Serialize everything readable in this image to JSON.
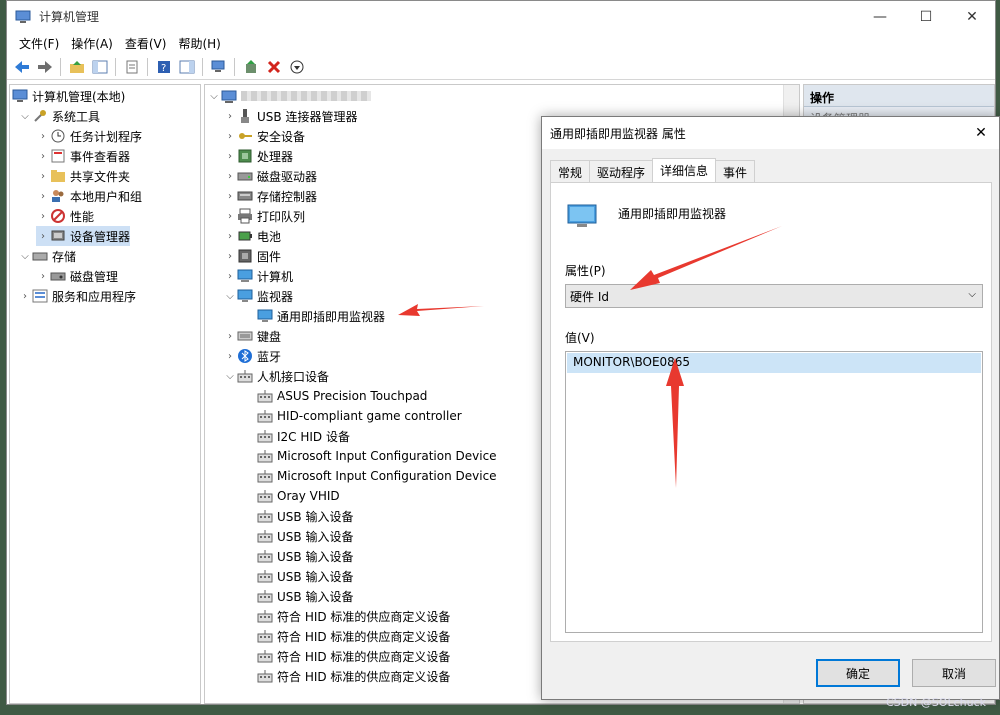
{
  "window": {
    "title": "计算机管理",
    "controls": {
      "minimize": "—",
      "maximize": "☐",
      "close": "✕"
    }
  },
  "menu": [
    "文件(F)",
    "操作(A)",
    "查看(V)",
    "帮助(H)"
  ],
  "left_tree": {
    "root": "计算机管理(本地)",
    "items": [
      {
        "label": "系统工具",
        "level": 1,
        "expanded": true,
        "icon": "tools-icon"
      },
      {
        "label": "任务计划程序",
        "level": 2,
        "icon": "clock-icon"
      },
      {
        "label": "事件查看器",
        "level": 2,
        "icon": "event-viewer-icon"
      },
      {
        "label": "共享文件夹",
        "level": 2,
        "icon": "shared-folder-icon"
      },
      {
        "label": "本地用户和组",
        "level": 2,
        "icon": "users-icon"
      },
      {
        "label": "性能",
        "level": 2,
        "icon": "performance-icon"
      },
      {
        "label": "设备管理器",
        "level": 2,
        "icon": "device-manager-icon",
        "selected": true
      },
      {
        "label": "存储",
        "level": 1,
        "expanded": true,
        "icon": "storage-icon"
      },
      {
        "label": "磁盘管理",
        "level": 2,
        "icon": "disk-icon"
      },
      {
        "label": "服务和应用程序",
        "level": 1,
        "icon": "services-icon"
      }
    ]
  },
  "device_tree": {
    "items": [
      {
        "label": "USB 连接器管理器",
        "level": 1,
        "icon": "usb-icon"
      },
      {
        "label": "安全设备",
        "level": 1,
        "icon": "key-icon"
      },
      {
        "label": "处理器",
        "level": 1,
        "icon": "cpu-icon"
      },
      {
        "label": "磁盘驱动器",
        "level": 1,
        "icon": "drive-icon"
      },
      {
        "label": "存储控制器",
        "level": 1,
        "icon": "storage-controller-icon"
      },
      {
        "label": "打印队列",
        "level": 1,
        "icon": "printer-icon"
      },
      {
        "label": "电池",
        "level": 1,
        "icon": "battery-icon"
      },
      {
        "label": "固件",
        "level": 1,
        "icon": "firmware-icon"
      },
      {
        "label": "计算机",
        "level": 1,
        "icon": "computer-icon"
      },
      {
        "label": "监视器",
        "level": 1,
        "icon": "monitor-icon",
        "expanded": true
      },
      {
        "label": "通用即插即用监视器",
        "level": 2,
        "icon": "monitor-icon"
      },
      {
        "label": "键盘",
        "level": 1,
        "icon": "keyboard-icon"
      },
      {
        "label": "蓝牙",
        "level": 1,
        "icon": "bluetooth-icon"
      },
      {
        "label": "人机接口设备",
        "level": 1,
        "icon": "hid-icon",
        "expanded": true
      },
      {
        "label": "ASUS Precision Touchpad",
        "level": 2,
        "icon": "hid-icon"
      },
      {
        "label": "HID-compliant game controller",
        "level": 2,
        "icon": "hid-icon"
      },
      {
        "label": "I2C HID 设备",
        "level": 2,
        "icon": "hid-icon"
      },
      {
        "label": "Microsoft Input Configuration Device",
        "level": 2,
        "icon": "hid-icon"
      },
      {
        "label": "Microsoft Input Configuration Device",
        "level": 2,
        "icon": "hid-icon"
      },
      {
        "label": "Oray VHID",
        "level": 2,
        "icon": "hid-icon"
      },
      {
        "label": "USB 输入设备",
        "level": 2,
        "icon": "hid-icon"
      },
      {
        "label": "USB 输入设备",
        "level": 2,
        "icon": "hid-icon"
      },
      {
        "label": "USB 输入设备",
        "level": 2,
        "icon": "hid-icon"
      },
      {
        "label": "USB 输入设备",
        "level": 2,
        "icon": "hid-icon"
      },
      {
        "label": "USB 输入设备",
        "level": 2,
        "icon": "hid-icon"
      },
      {
        "label": "符合 HID 标准的供应商定义设备",
        "level": 2,
        "icon": "hid-icon"
      },
      {
        "label": "符合 HID 标准的供应商定义设备",
        "level": 2,
        "icon": "hid-icon"
      },
      {
        "label": "符合 HID 标准的供应商定义设备",
        "level": 2,
        "icon": "hid-icon"
      },
      {
        "label": "符合 HID 标准的供应商定义设备",
        "level": 2,
        "icon": "hid-icon"
      }
    ]
  },
  "actions_pane": {
    "header": "操作",
    "sub": "设备管理器"
  },
  "dialog": {
    "title": "通用即插即用监视器 属性",
    "tabs": [
      "常规",
      "驱动程序",
      "详细信息",
      "事件"
    ],
    "active_tab": "详细信息",
    "device_name": "通用即插即用监视器",
    "property_label": "属性(P)",
    "property_value": "硬件 Id",
    "value_label": "值(V)",
    "values": [
      "MONITOR\\BOE0865"
    ],
    "ok": "确定",
    "cancel": "取消"
  },
  "watermark": "CSDN @SOLchuck",
  "colors": {
    "arrow": "#e8392f",
    "selection": "#cde0f5",
    "accent": "#0078d7"
  }
}
